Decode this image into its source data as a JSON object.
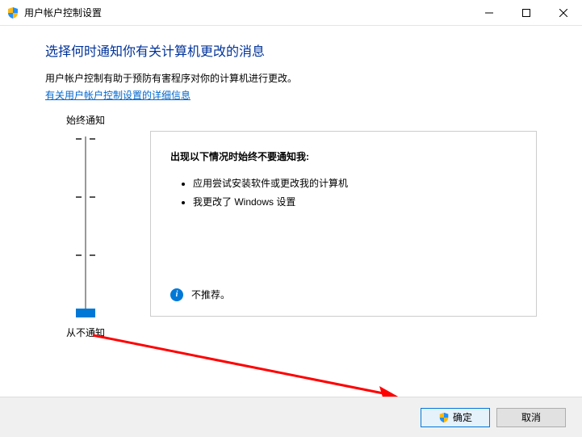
{
  "window": {
    "title": "用户帐户控制设置"
  },
  "heading": "选择何时通知你有关计算机更改的消息",
  "description": "用户帐户控制有助于预防有害程序对你的计算机进行更改。",
  "link_text": "有关用户帐户控制设置的详细信息",
  "slider": {
    "top_label": "始终通知",
    "bottom_label": "从不通知"
  },
  "panel": {
    "title": "出现以下情况时始终不要通知我:",
    "items": [
      "应用尝试安装软件或更改我的计算机",
      "我更改了 Windows 设置"
    ],
    "footer": "不推荐。"
  },
  "buttons": {
    "ok": "确定",
    "cancel": "取消"
  }
}
